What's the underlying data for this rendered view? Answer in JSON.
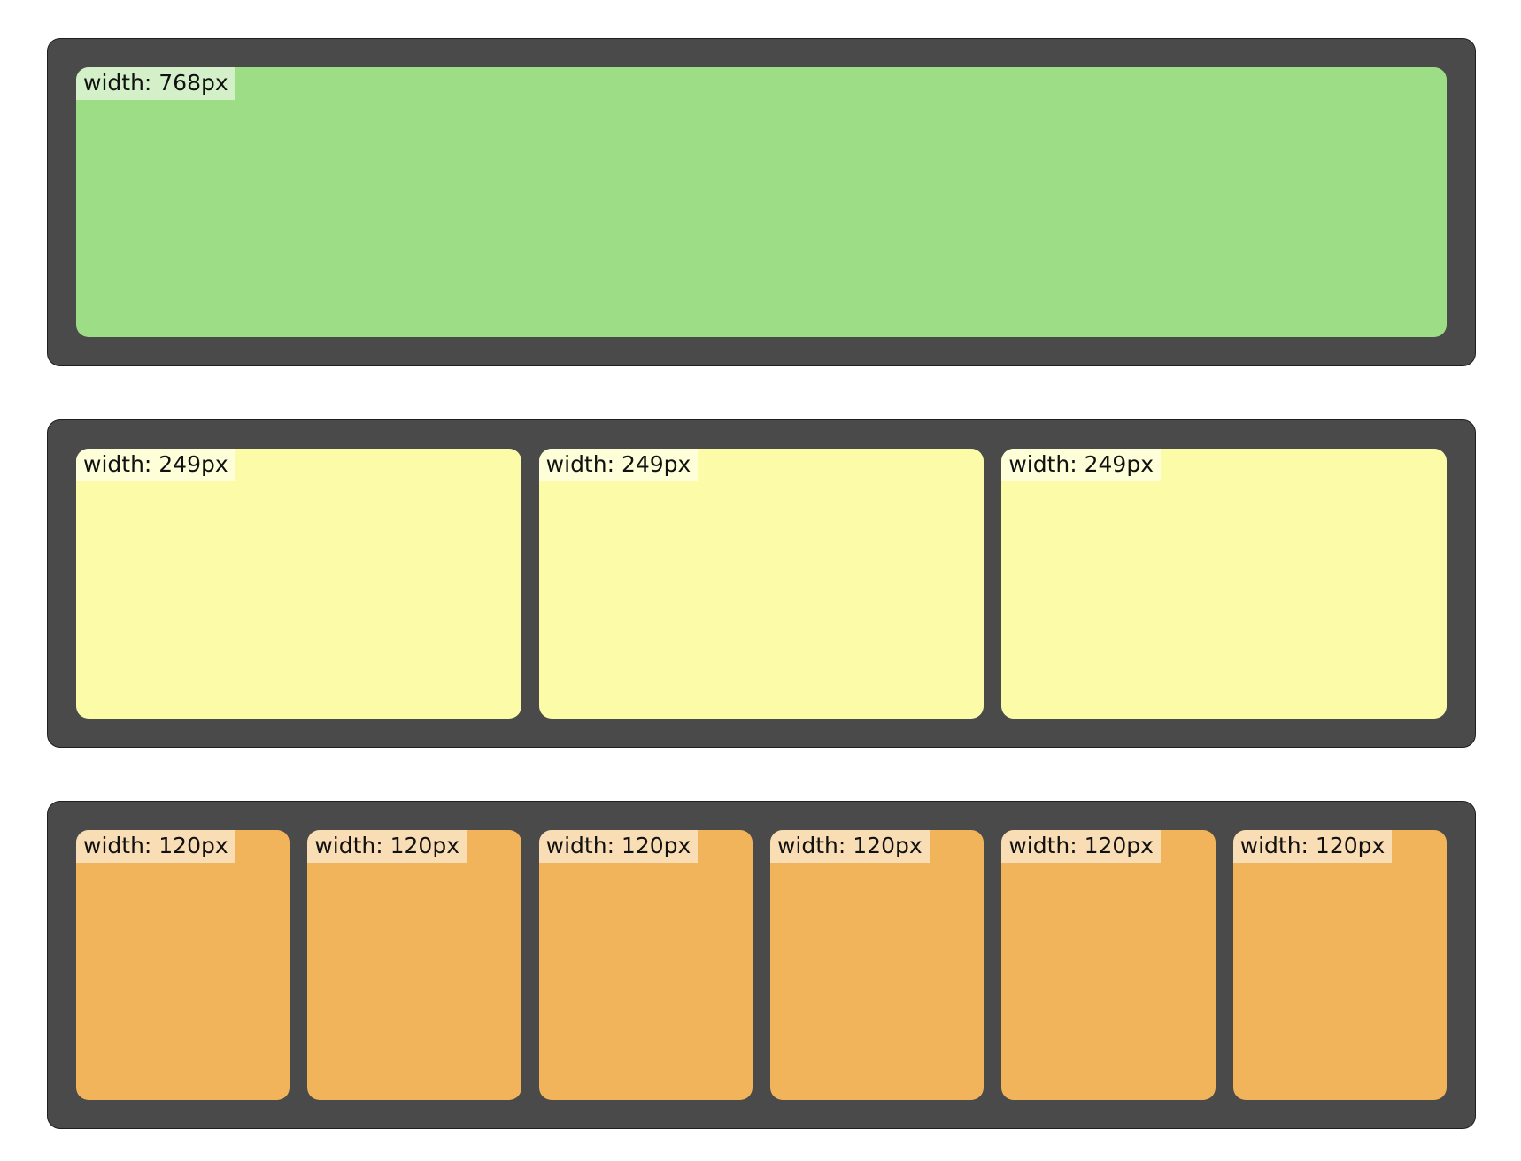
{
  "colors": {
    "container": "#4a4a4a",
    "green": "#9ddd85",
    "yellow": "#fcfca8",
    "orange": "#f2b45b"
  },
  "rows": [
    {
      "color": "#9ddd85",
      "boxes": [
        {
          "label": "width: 768px"
        }
      ]
    },
    {
      "color": "#fcfca8",
      "boxes": [
        {
          "label": "width: 249px"
        },
        {
          "label": "width: 249px"
        },
        {
          "label": "width: 249px"
        }
      ]
    },
    {
      "color": "#f2b45b",
      "boxes": [
        {
          "label": "width: 120px"
        },
        {
          "label": "width: 120px"
        },
        {
          "label": "width: 120px"
        },
        {
          "label": "width: 120px"
        },
        {
          "label": "width: 120px"
        },
        {
          "label": "width: 120px"
        }
      ]
    }
  ]
}
